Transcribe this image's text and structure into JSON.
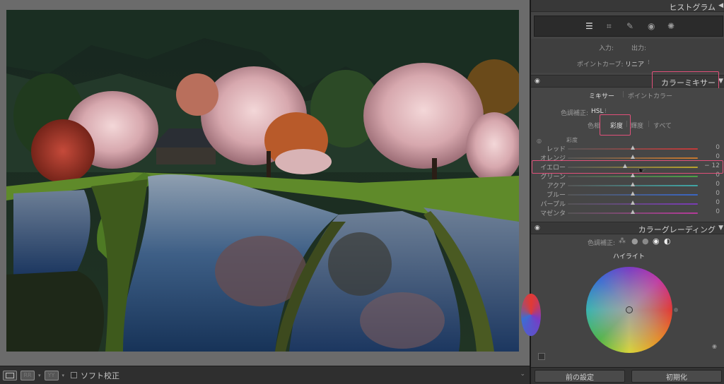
{
  "panel": {
    "histogram_title": "ヒストグラム",
    "tone_curve": {
      "input_label": "入力:",
      "output_label": "出力:",
      "point_curve_label": "ポイントカーブ:",
      "point_curve_value": "リニア"
    },
    "color_mixer": {
      "title": "カラーミキサー",
      "tabs": [
        "ミキサー",
        "ポイントカラー"
      ],
      "adjust_label": "色調補正:",
      "adjust_value": "HSL",
      "subtabs": [
        "色相",
        "彩度",
        "輝度",
        "すべて"
      ],
      "group_label": "彩度",
      "sliders": [
        {
          "label": "レッド",
          "value": "0",
          "position": 0.5
        },
        {
          "label": "オレンジ",
          "value": "0",
          "position": 0.5
        },
        {
          "label": "イエロー",
          "value": "− 12",
          "position": 0.44
        },
        {
          "label": "グリーン",
          "value": "0",
          "position": 0.5
        },
        {
          "label": "アクア",
          "value": "0",
          "position": 0.5
        },
        {
          "label": "ブルー",
          "value": "0",
          "position": 0.5
        },
        {
          "label": "パープル",
          "value": "0",
          "position": 0.5
        },
        {
          "label": "マゼンタ",
          "value": "0",
          "position": 0.5
        }
      ]
    },
    "color_grading": {
      "title": "カラーグレーディング",
      "adjust_label": "色調補正:",
      "wheel_label": "ハイライト"
    },
    "footer": {
      "previous_button": "前の設定",
      "reset_button": "初期化"
    }
  },
  "toolbar": {
    "view_a": "RR",
    "view_b": "YY",
    "softproof_label": "ソフト校正"
  },
  "colors": {
    "highlight": "#e0507a",
    "panel_bg": "#444444",
    "photo_frame": "#6b6b6b"
  }
}
